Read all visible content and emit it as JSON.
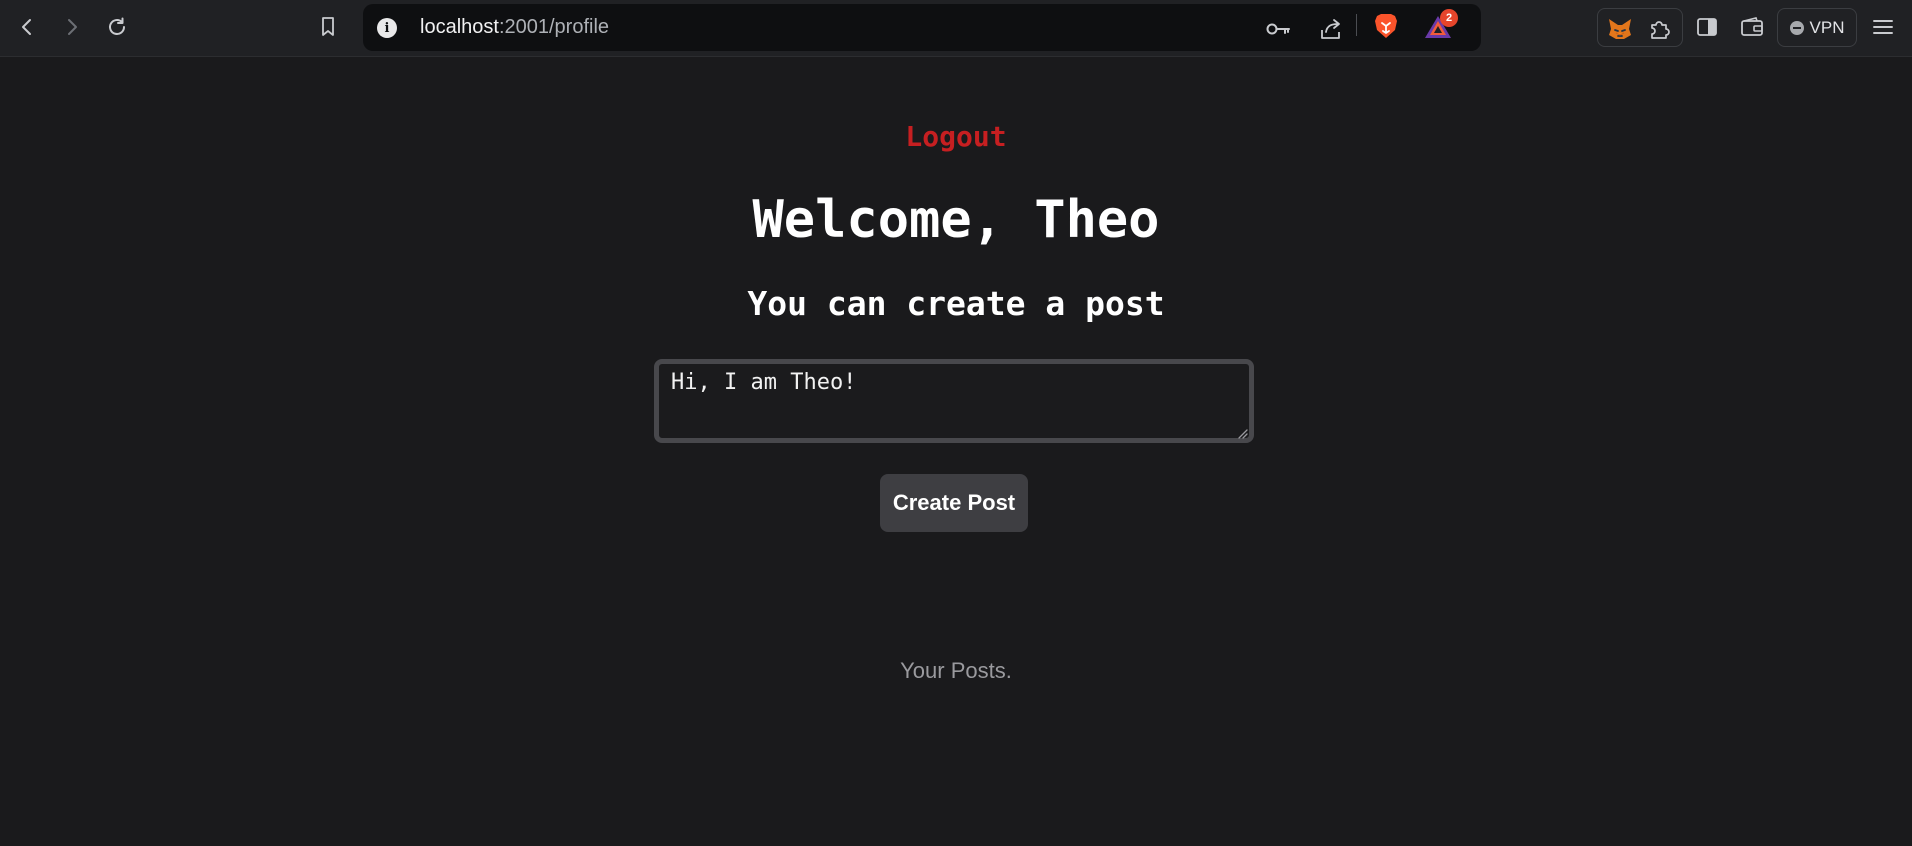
{
  "browser": {
    "url_host": "localhost",
    "url_path": ":2001/profile",
    "rewards_badge": "2",
    "vpn_label": "VPN"
  },
  "page": {
    "logout_label": "Logout",
    "welcome_heading": "Welcome, Theo",
    "subtitle": "You can create a post",
    "post_input_value": "Hi, I am Theo!",
    "create_button_label": "Create Post",
    "your_posts_label": "Your Posts."
  },
  "colors": {
    "page_background": "#1a1a1c",
    "logout_red": "#c61f21",
    "button_background": "#3e3e42"
  }
}
